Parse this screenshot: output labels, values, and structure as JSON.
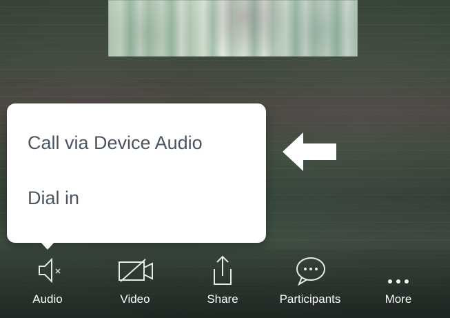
{
  "audio_menu": {
    "items": [
      {
        "label": "Call via Device Audio"
      },
      {
        "label": "Dial in"
      }
    ]
  },
  "toolbar": {
    "items": [
      {
        "label": "Audio",
        "icon": "speaker-icon"
      },
      {
        "label": "Video",
        "icon": "video-off-icon"
      },
      {
        "label": "Share",
        "icon": "share-icon"
      },
      {
        "label": "Participants",
        "icon": "chat-bubble-icon"
      },
      {
        "label": "More",
        "icon": "more-dots-icon"
      }
    ]
  },
  "colors": {
    "popup_background": "#ffffff",
    "menu_text": "#4b5560",
    "toolbar_text": "#ffffff",
    "arrow": "#ffffff"
  }
}
